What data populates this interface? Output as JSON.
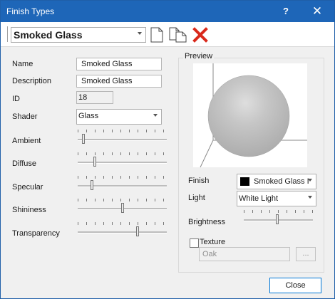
{
  "window": {
    "title": "Finish Types",
    "help_label": "?"
  },
  "toolbar": {
    "selected_finish": "Smoked Glass"
  },
  "properties": {
    "name_label": "Name",
    "name_value": "Smoked Glass",
    "description_label": "Description",
    "description_value": "Smoked Glass",
    "id_label": "ID",
    "id_value": "18",
    "shader_label": "Shader",
    "shader_value": "Glass",
    "ambient_label": "Ambient",
    "ambient_level": 0.05,
    "diffuse_label": "Diffuse",
    "diffuse_level": 0.18,
    "specular_label": "Specular",
    "specular_level": 0.15,
    "shininess_label": "Shininess",
    "shininess_level": 0.5,
    "transparency_label": "Transparency",
    "transparency_level": 0.68
  },
  "preview": {
    "label": "Preview",
    "finish_label": "Finish",
    "finish_value": "Smoked Glass I",
    "light_label": "Light",
    "light_value": "White Light",
    "brightness_label": "Brightness",
    "brightness_level": 0.48,
    "texture_label": "Texture",
    "texture_value": "Oak",
    "browse_label": "..."
  },
  "footer": {
    "close_label": "Close"
  },
  "colors": {
    "title_bar": "#1e66b8",
    "delete_icon": "#d9291b",
    "sphere": "#bfbfbf"
  }
}
